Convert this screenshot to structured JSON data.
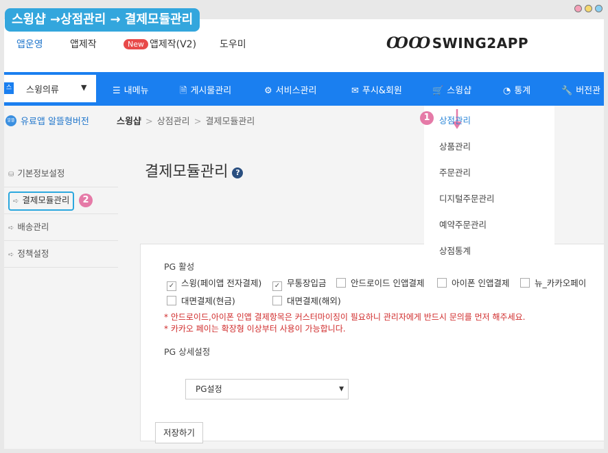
{
  "banner": {
    "title": "스윙샵 →상점관리 → 결제모듈관리"
  },
  "window_dots": {
    "colors": [
      "#f5a0b8",
      "#f5d870",
      "#8ad0f2"
    ]
  },
  "top_nav": {
    "items": [
      "앱운영",
      "앱제작",
      "앱제작(V2)",
      "도우미"
    ],
    "new_badge": "New",
    "active_color": "#2277cc"
  },
  "logo": {
    "mark": "ꝎꝎ",
    "text": "SWING2APP"
  },
  "main_nav": {
    "app_select": {
      "icon_text": "스",
      "value": "스윙의류"
    },
    "items": [
      {
        "icon": "menu-icon",
        "glyph": "☰",
        "label": "내메뉴"
      },
      {
        "icon": "document-icon",
        "glyph": "🗎",
        "label": "게시물관리"
      },
      {
        "icon": "gear-icon",
        "glyph": "⚙",
        "label": "서비스관리"
      },
      {
        "icon": "mail-icon",
        "glyph": "✉",
        "label": "푸시&회원"
      },
      {
        "icon": "cart-icon",
        "glyph": "🛒",
        "label": "스윙샵"
      },
      {
        "icon": "chart-icon",
        "glyph": "◔",
        "label": "통계"
      },
      {
        "icon": "wrench-icon",
        "glyph": "🔧",
        "label": "버전관"
      }
    ],
    "bar_color": "#1a7ff0"
  },
  "crumb_bar": {
    "paid_badge": "알뜰",
    "paid_text": "유료앱 알뜰형버전",
    "crumbs": [
      "스윙샵",
      "상점관리",
      "결제모듈관리"
    ]
  },
  "sidebar": {
    "items": [
      {
        "icon": "drive-icon",
        "glyph": "⛁",
        "label": "기본정보설정"
      },
      {
        "icon": "arrow-right-icon",
        "glyph": "➪",
        "label": "결제모듈관리"
      },
      {
        "icon": "arrow-right-icon",
        "glyph": "➪",
        "label": "배송관리"
      },
      {
        "icon": "arrow-right-icon",
        "glyph": "➪",
        "label": "정책설정"
      }
    ]
  },
  "page": {
    "title": "결제모듈관리",
    "help_glyph": "?"
  },
  "form": {
    "pg_active_label": "PG 활성",
    "options": [
      {
        "label": "스윙(페이앱 전자결제)",
        "checked": true
      },
      {
        "label": "무통장입금",
        "checked": true
      },
      {
        "label": "안드로이드 인앱결제",
        "checked": false
      },
      {
        "label": "아이폰 인앱결제",
        "checked": false
      },
      {
        "label": "뉴_카카오페이",
        "checked": false
      },
      {
        "label": "대면결제(현금)",
        "checked": false
      },
      {
        "label": "대면결제(해외)",
        "checked": false
      }
    ],
    "warnings": [
      "* 안드로이드,아이폰 인앱 결제항목은 커스터마이징이 필요하니 관리자에게 반드시 문의를 먼저 해주세요.",
      "* 카카오 페이는 확장형 이상부터 사용이 가능합니다."
    ],
    "pg_detail_label": "PG 상세설정",
    "pg_select_value": "PG설정",
    "save_label": "저장하기"
  },
  "dropdown": {
    "items": [
      "상점관리",
      "상품관리",
      "주문관리",
      "디지털주문관리",
      "예약주문관리",
      "상점통계"
    ]
  },
  "markers": {
    "one": "1",
    "two": "2",
    "color": "#e57aa7"
  }
}
